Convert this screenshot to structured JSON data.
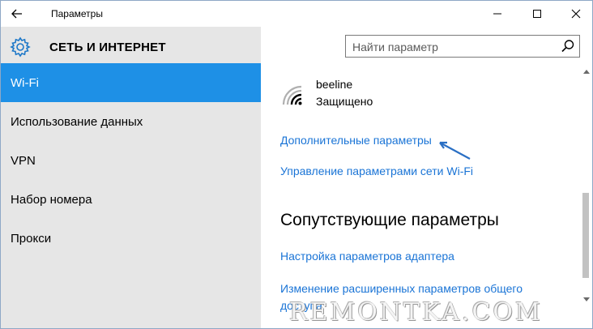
{
  "window": {
    "title": "Параметры"
  },
  "header": {
    "section_title": "СЕТЬ И ИНТЕРНЕТ"
  },
  "search": {
    "placeholder": "Найти параметр"
  },
  "sidebar": {
    "items": [
      {
        "label": "Wi-Fi",
        "selected": true
      },
      {
        "label": "Использование данных"
      },
      {
        "label": "VPN"
      },
      {
        "label": "Набор номера"
      },
      {
        "label": "Прокси"
      }
    ]
  },
  "network": {
    "name": "beeline",
    "status": "Защищено"
  },
  "links": {
    "advanced": "Дополнительные параметры",
    "manage_wifi": "Управление параметрами сети Wi-Fi",
    "adapter": "Настройка параметров адаптера",
    "sharing": "Изменение расширенных параметров общего доступа"
  },
  "related": {
    "heading": "Сопутствующие параметры"
  },
  "watermark": {
    "text": "REMONTKA.COM"
  },
  "colors": {
    "accent": "#1e90e6",
    "link": "#1a74d6",
    "sidebar_bg": "#e6e6e6",
    "window_border": "#8ea8c6"
  },
  "icons": {
    "back": "back-arrow-icon",
    "settings": "gear-icon",
    "search": "search-icon",
    "wifi": "wifi-signal-icon",
    "minimize": "minimize-icon",
    "maximize": "maximize-icon",
    "close": "close-icon"
  }
}
